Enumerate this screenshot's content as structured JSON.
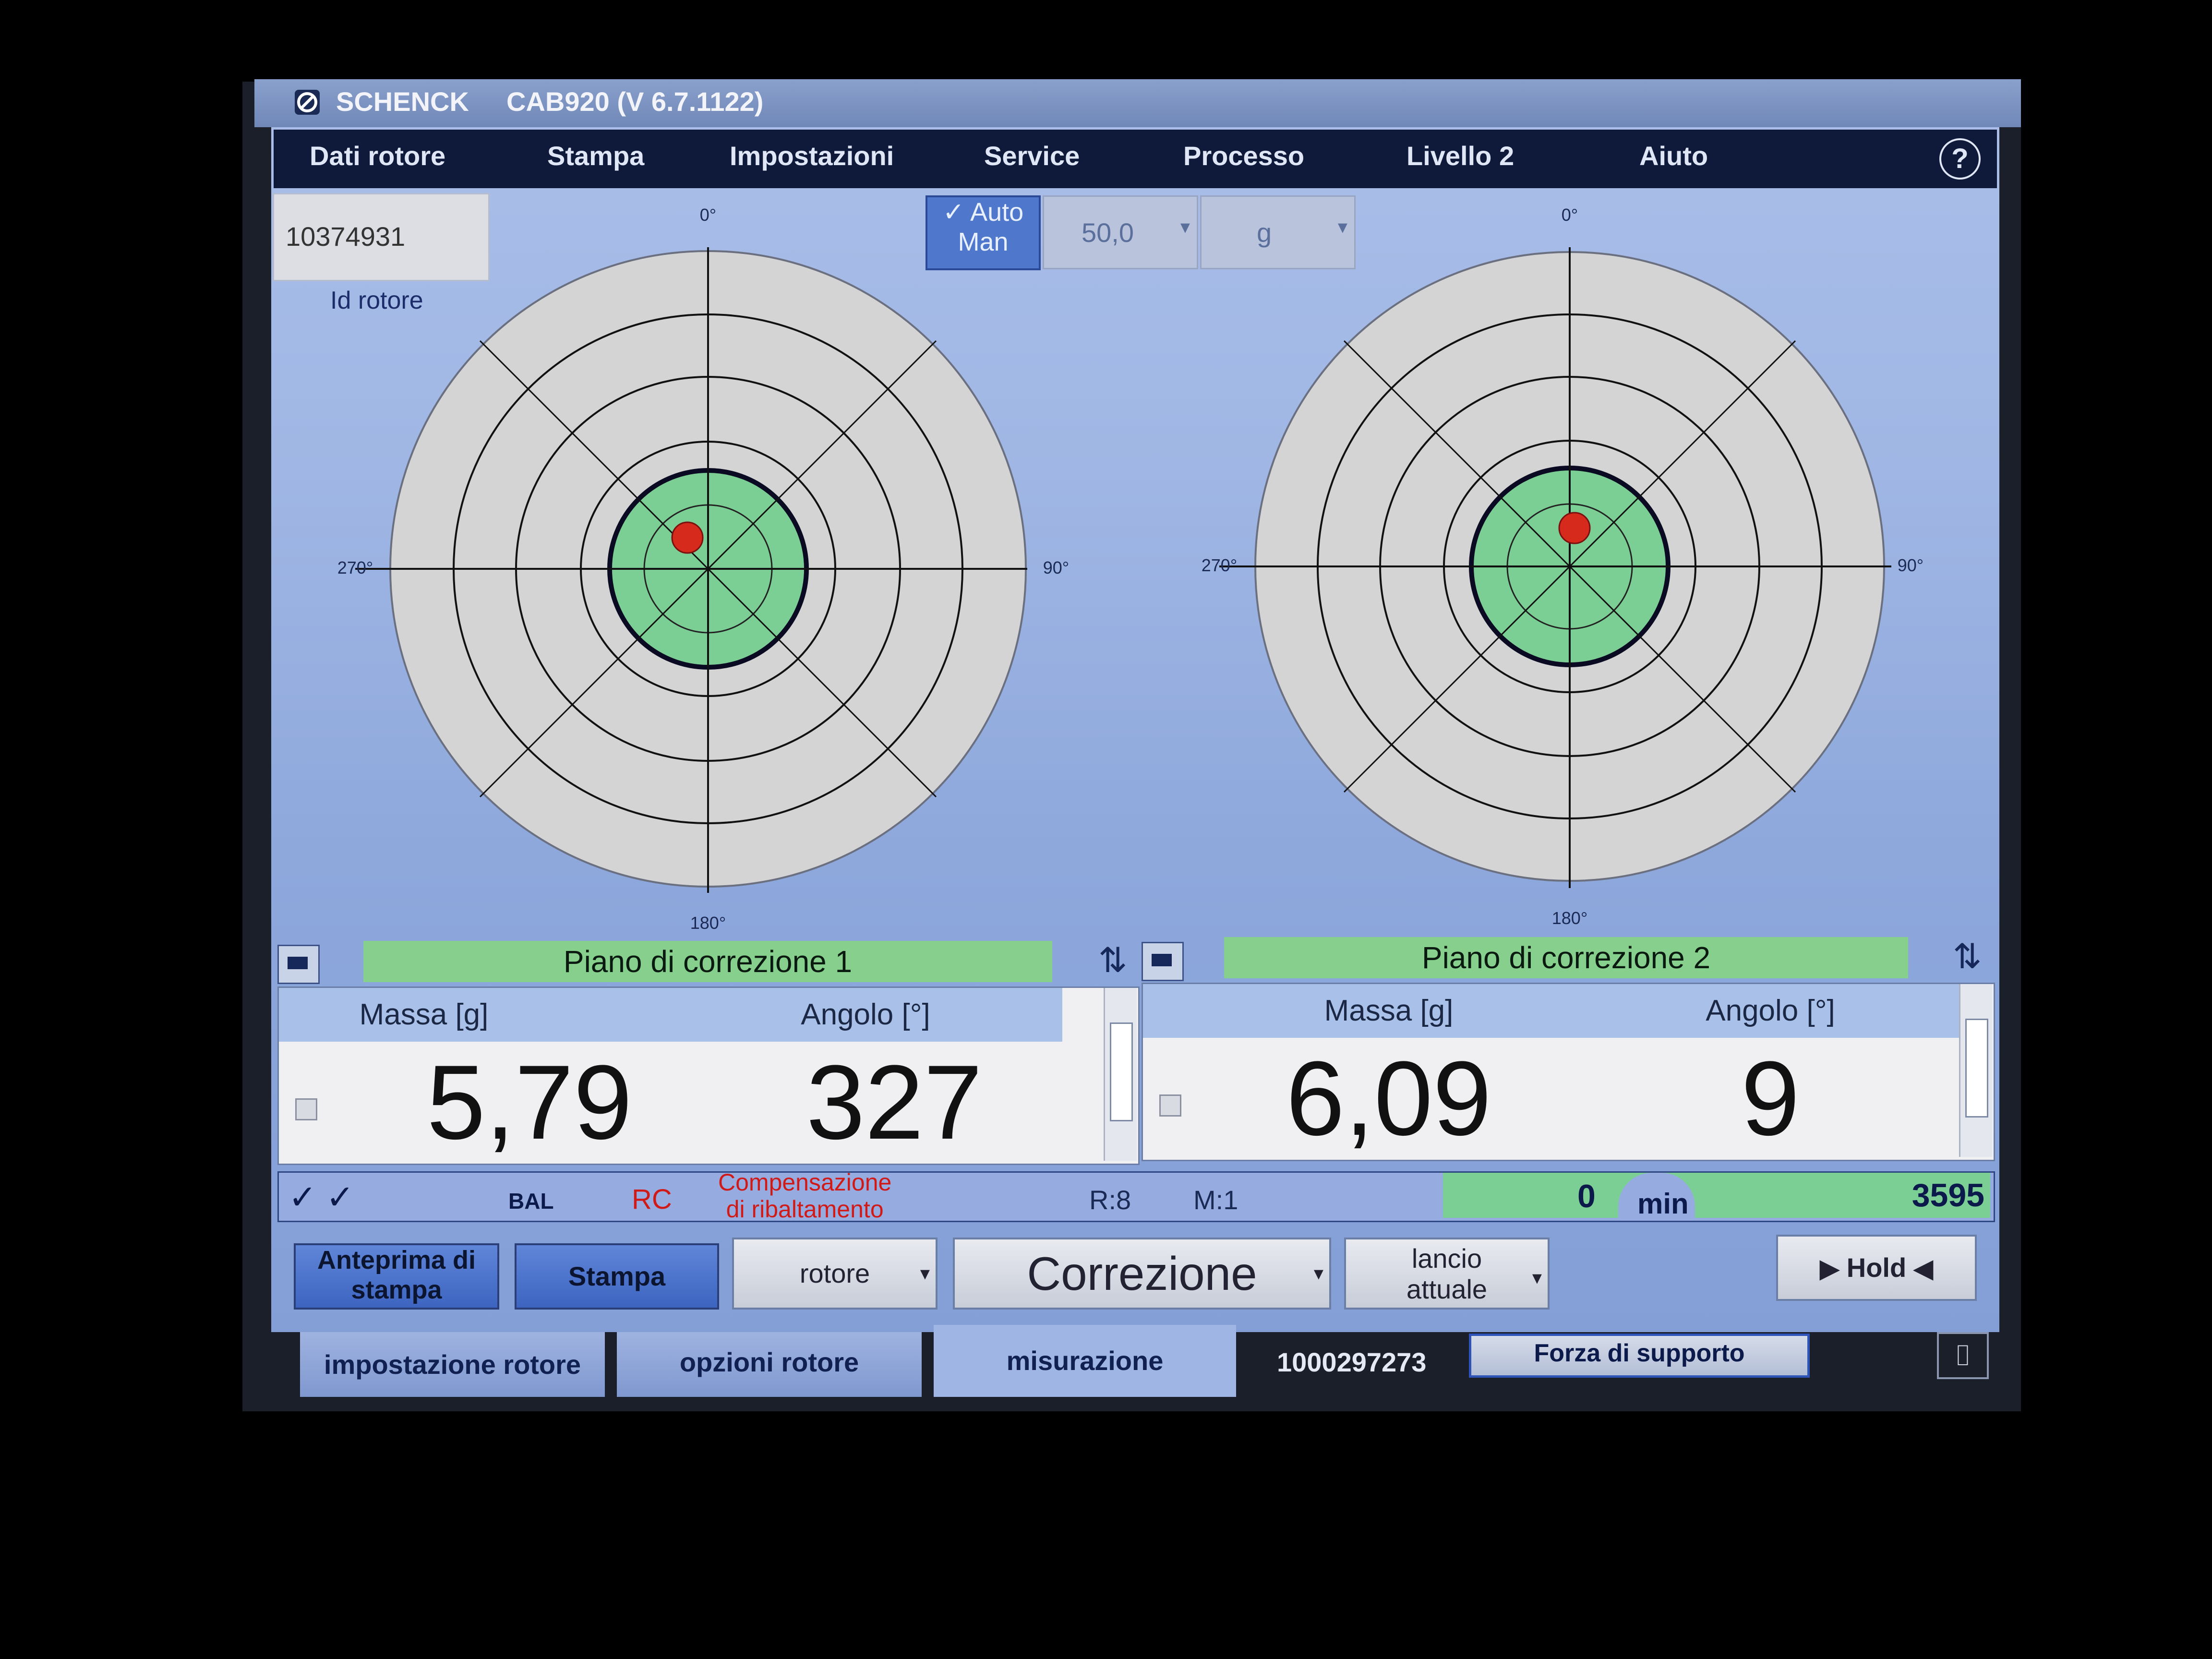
{
  "title_bar": {
    "brand": "SCHENCK",
    "version": "CAB920 (V 6.7.1122)"
  },
  "menu": [
    "Dati rotore",
    "Stampa",
    "Impostazioni",
    "Service",
    "Processo",
    "Livello 2",
    "Aiuto"
  ],
  "help_label": "?",
  "rotor_id": {
    "value": "10374931",
    "label": "Id rotore"
  },
  "auto_man": {
    "check": "✓",
    "auto": "Auto",
    "man": "Man"
  },
  "tolerance": {
    "value": "50,0",
    "unit": "g"
  },
  "polar_labels": {
    "top": "0°",
    "right": "90°",
    "bottom": "180°",
    "left": "270°"
  },
  "planes": [
    {
      "title": "Piano di correzione 1",
      "mass_header": "Massa [g]",
      "angle_header": "Angolo [°]",
      "mass": "5,79",
      "angle": "327"
    },
    {
      "title": "Piano di correzione 2",
      "mass_header": "Massa [g]",
      "angle_header": "Angolo [°]",
      "mass": "6,09",
      "angle": "9"
    }
  ],
  "status": {
    "checks": "✓ ✓",
    "bal": "BAL",
    "rc": "RC",
    "compensation": [
      "Compensazione",
      "di ribaltamento"
    ],
    "r": "R:8",
    "m": "M:1",
    "speed_current": "0",
    "speed_unit": "min",
    "speed_target": "3595"
  },
  "buttons": {
    "preview": [
      "Anteprima di",
      "stampa"
    ],
    "print": "Stampa",
    "rotor_select": "rotore",
    "mode_select": "Correzione",
    "run_select": [
      "lancio",
      "attuale"
    ],
    "hold": "Hold"
  },
  "tabs": [
    "impostazione rotore",
    "opzioni rotore",
    "misurazione"
  ],
  "footer": {
    "serial": "1000297273",
    "support_force": "Forza di supporto"
  },
  "colors": {
    "menu_bg": "#0f1a3a",
    "screen_bg": "#9fb6e4",
    "target_green": "#7ccf94",
    "marker_red": "#d62a1c",
    "plane_green": "#86cf8c"
  }
}
